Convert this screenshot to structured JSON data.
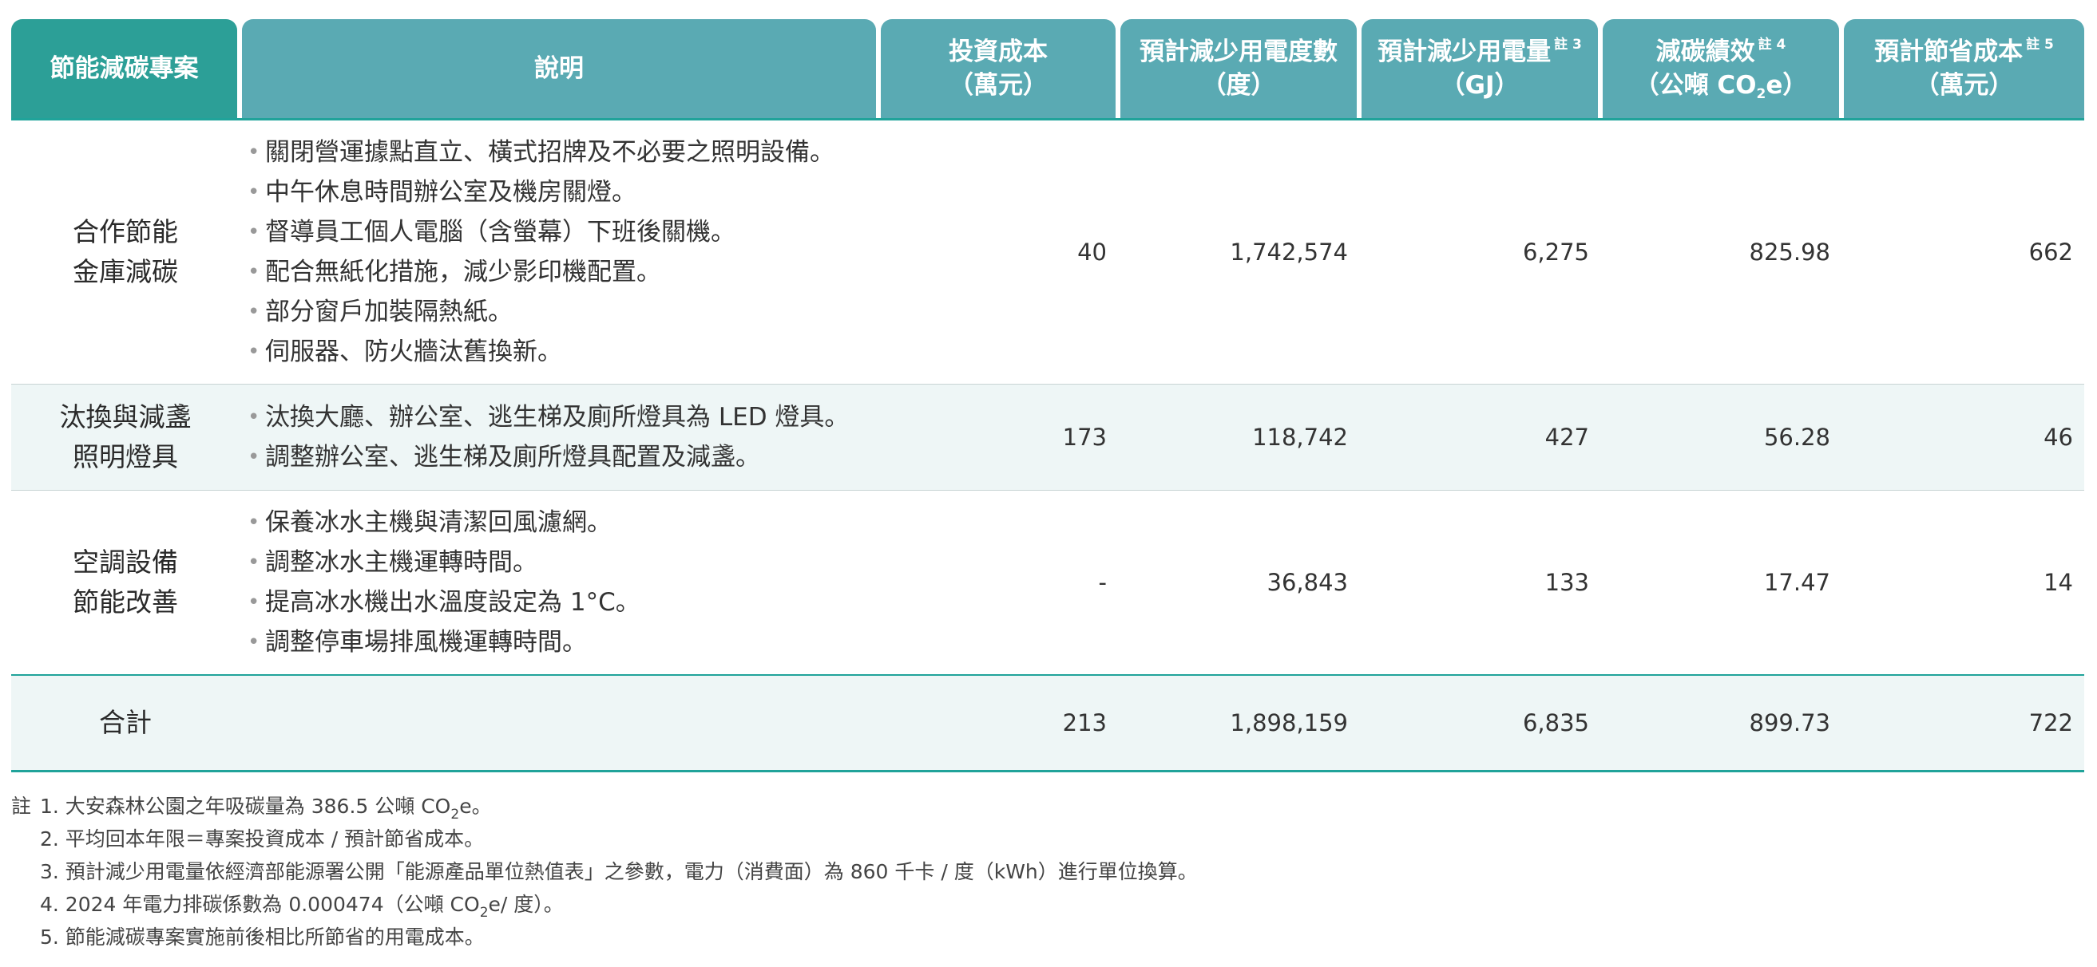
{
  "header": {
    "project": "節能減碳專案",
    "description": "說明",
    "invest_l1": "投資成本",
    "invest_l2": "（萬元）",
    "kwh_l1": "預計減少用電度數",
    "kwh_l2": "（度）",
    "gj_l1": "預計減少用電量",
    "gj_sup": "註 3",
    "gj_l2": "（GJ）",
    "carbon_l1": "減碳績效",
    "carbon_sup": "註 4",
    "carbon_l2a": "（公噸 CO",
    "carbon_sub": "2",
    "carbon_l2b": "e）",
    "save_l1": "預計節省成本",
    "save_sup": "註 5",
    "save_l2": "（萬元）"
  },
  "rows": [
    {
      "name1": "合作節能",
      "name2": "金庫減碳",
      "items": [
        "關閉營運據點直立、橫式招牌及不必要之照明設備。",
        "中午休息時間辦公室及機房關燈。",
        "督導員工個人電腦（含螢幕）下班後關機。",
        "配合無紙化措施，減少影印機配置。",
        "部分窗戶加裝隔熱紙。",
        "伺服器、防火牆汰舊換新。"
      ],
      "invest": "40",
      "kwh": "1,742,574",
      "gj": "6,275",
      "carbon": "825.98",
      "save": "662"
    },
    {
      "name1": "汰換與減盞",
      "name2": "照明燈具",
      "items": [
        "汰換大廳、辦公室、逃生梯及廁所燈具為 LED 燈具。",
        "調整辦公室、逃生梯及廁所燈具配置及減盞。"
      ],
      "invest": "173",
      "kwh": "118,742",
      "gj": "427",
      "carbon": "56.28",
      "save": "46"
    },
    {
      "name1": "空調設備",
      "name2": "節能改善",
      "items": [
        "保養冰水主機與清潔回風濾網。",
        "調整冰水主機運轉時間。",
        "提高冰水機出水溫度設定為 1°C。",
        "調整停車場排風機運轉時間。"
      ],
      "invest": "-",
      "kwh": "36,843",
      "gj": "133",
      "carbon": "17.47",
      "save": "14"
    }
  ],
  "total": {
    "name": "合計",
    "invest": "213",
    "kwh": "1,898,159",
    "gj": "6,835",
    "carbon": "899.73",
    "save": "722"
  },
  "notes": {
    "lead": "註",
    "n1a": "1. 大安森林公園之年吸碳量為 386.5 公噸 CO",
    "n1sub": "2",
    "n1b": "e。",
    "n2": "2. 平均回本年限＝專案投資成本 / 預計節省成本。",
    "n3": "3. 預計減少用電量依經濟部能源署公開「能源產品單位熱值表」之參數，電力（消費面）為 860 千卡 / 度（kWh）進行單位換算。",
    "n4a": "4. 2024 年電力排碳係數為 0.000474（公噸 CO",
    "n4sub": "2",
    "n4b": "e/ 度）。",
    "n5": "5. 節能減碳專案實施前後相比所節省的用電成本。"
  }
}
